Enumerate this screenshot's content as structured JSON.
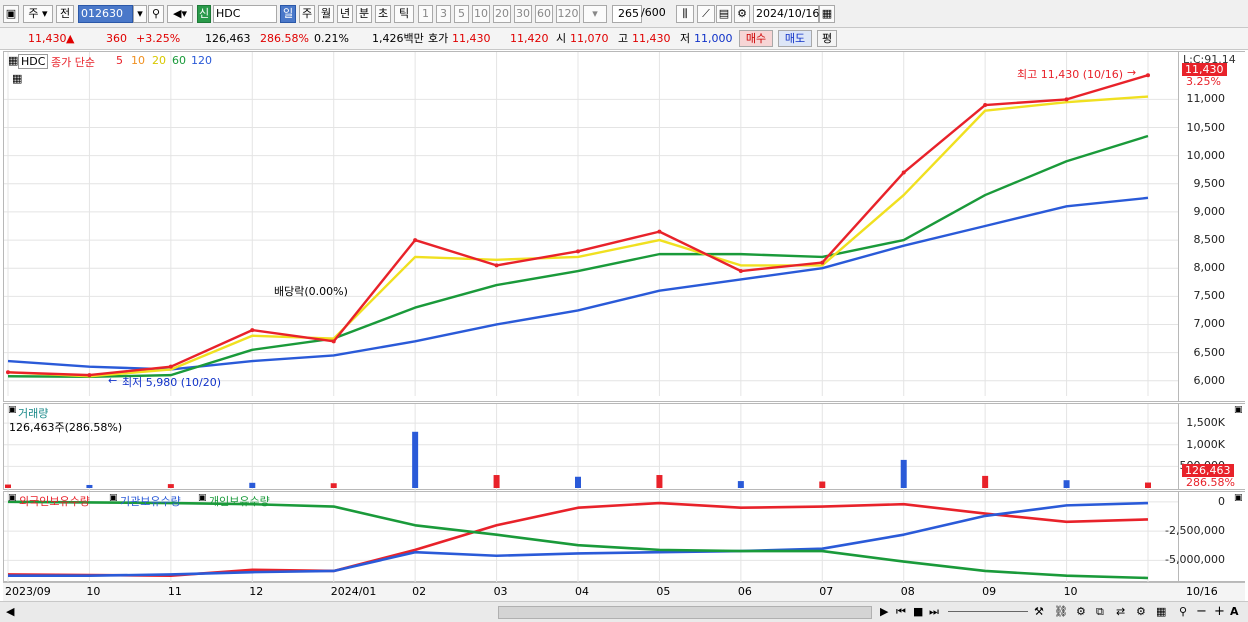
{
  "toolbar": {
    "market_tab": "주",
    "prev_label": "전",
    "code": "012630",
    "name_badge": "신",
    "name": "HDC",
    "periods": [
      "일",
      "주",
      "월",
      "년",
      "분",
      "초",
      "틱"
    ],
    "numbers": [
      "1",
      "3",
      "5",
      "10",
      "20",
      "30",
      "60",
      "120"
    ],
    "count_value": "265",
    "count_max": "/600",
    "date": "2024/10/16"
  },
  "quote": {
    "price": "11,430",
    "change_arrow": "▲",
    "change": "360",
    "change_pct": "+3.25%",
    "volume": "126,463",
    "volume_pct": "286.58%",
    "turnover_pct": "0.21%",
    "amount": "1,426백만",
    "ask_label": "호가",
    "ask": "11,430",
    "bid": "11,420",
    "open_label": "시",
    "open": "11,070",
    "high_label": "고",
    "high": "11,430",
    "low_label": "저",
    "low": "11,000",
    "buy_button": "매수",
    "sell_button": "매도",
    "eval_button": "평"
  },
  "price_panel": {
    "symbol": "HDC",
    "ma_legend_title": "종가 단순",
    "ma_periods": [
      "5",
      "10",
      "20",
      "60",
      "120"
    ],
    "ma_colors": [
      "#e8222a",
      "#f09020",
      "#f0e020",
      "#1a9a3a",
      "#2a5ad8"
    ],
    "dividend_note": "배당락(0.00%)",
    "high_note": "최고 11,430 (10/16)",
    "low_note": "최저 5,980 (10/20)",
    "axis_header": "L:C:91.14",
    "price_tag": "11,430",
    "pct_tag": "3.25%"
  },
  "volume_panel": {
    "title": "거래량",
    "value_line": "126,463주(286.58%)",
    "axis_tag": "126,463",
    "pct_tag": "286.58%"
  },
  "holdings_panel": {
    "legend": [
      "외국인보유수량",
      "기관보유수량",
      "개인보유수량"
    ],
    "legend_colors": [
      "#e8222a",
      "#2a5ad8",
      "#1a9a3a"
    ]
  },
  "x_axis": {
    "labels": [
      "2023/09",
      "10",
      "11",
      "12",
      "2024/01",
      "02",
      "03",
      "04",
      "05",
      "06",
      "07",
      "08",
      "09",
      "10"
    ],
    "right_label": "10/16"
  },
  "chart_data": [
    {
      "type": "line",
      "title": "HDC",
      "ylabel": "",
      "y_ticks": [
        "11,000",
        "10,500",
        "10,000",
        "9,500",
        "9,000",
        "8,500",
        "8,000",
        "7,500",
        "7,000",
        "6,500",
        "6,000"
      ],
      "ylim": [
        5800,
        11700
      ],
      "x": [
        "2023/09",
        "10",
        "11",
        "12",
        "2024/01",
        "02",
        "03",
        "04",
        "05",
        "06",
        "07",
        "08",
        "09",
        "10",
        "10/16"
      ],
      "series": [
        {
          "name": "5",
          "color": "#e8222a",
          "values": [
            6150,
            6100,
            6250,
            6900,
            6700,
            8500,
            8050,
            8300,
            8650,
            7950,
            8100,
            9700,
            10900,
            11000,
            11430
          ]
        },
        {
          "name": "20",
          "color": "#f0e020",
          "values": [
            6150,
            6080,
            6200,
            6800,
            6750,
            8200,
            8150,
            8200,
            8500,
            8050,
            8050,
            9300,
            10800,
            10950,
            11050
          ]
        },
        {
          "name": "60",
          "color": "#1a9a3a",
          "values": [
            6080,
            6070,
            6100,
            6550,
            6750,
            7300,
            7700,
            7950,
            8250,
            8250,
            8200,
            8500,
            9300,
            9900,
            10350
          ]
        },
        {
          "name": "120",
          "color": "#2a5ad8",
          "values": [
            6350,
            6250,
            6200,
            6350,
            6450,
            6700,
            7000,
            7250,
            7600,
            7800,
            8000,
            8400,
            8750,
            9100,
            9250
          ]
        }
      ]
    },
    {
      "type": "bar",
      "title": "거래량",
      "y_ticks": [
        "1,500K",
        "1,000K",
        "500,000"
      ],
      "ylim": [
        0,
        1850000
      ],
      "x": [
        "2023/09",
        "10",
        "11",
        "12",
        "2024/01",
        "02",
        "03",
        "04",
        "05",
        "06",
        "07",
        "08",
        "09",
        "10",
        "10/16"
      ],
      "values": [
        80000,
        70000,
        90000,
        120000,
        110000,
        1300000,
        300000,
        260000,
        300000,
        160000,
        150000,
        650000,
        280000,
        180000,
        126463
      ]
    },
    {
      "type": "line",
      "title": "보유수량",
      "y_ticks": [
        "0",
        "-2,500,000",
        "-5,000,000"
      ],
      "ylim": [
        -6500000,
        500000
      ],
      "x": [
        "2023/09",
        "10",
        "11",
        "12",
        "2024/01",
        "02",
        "03",
        "04",
        "05",
        "06",
        "07",
        "08",
        "09",
        "10",
        "10/16"
      ],
      "series": [
        {
          "name": "외국인보유수량",
          "color": "#e8222a",
          "values": [
            -6200000,
            -6250000,
            -6300000,
            -5800000,
            -5900000,
            -4100000,
            -2000000,
            -500000,
            -100000,
            -500000,
            -400000,
            -200000,
            -1000000,
            -1700000,
            -1500000
          ]
        },
        {
          "name": "기관보유수량",
          "color": "#2a5ad8",
          "values": [
            -6300000,
            -6300000,
            -6200000,
            -6000000,
            -5900000,
            -4300000,
            -4600000,
            -4400000,
            -4300000,
            -4200000,
            -4000000,
            -2800000,
            -1200000,
            -300000,
            -100000
          ]
        },
        {
          "name": "개인보유수량",
          "color": "#1a9a3a",
          "values": [
            0,
            -50000,
            -100000,
            -200000,
            -400000,
            -2000000,
            -2800000,
            -3700000,
            -4100000,
            -4200000,
            -4200000,
            -5100000,
            -5900000,
            -6300000,
            -6500000
          ]
        }
      ]
    }
  ]
}
